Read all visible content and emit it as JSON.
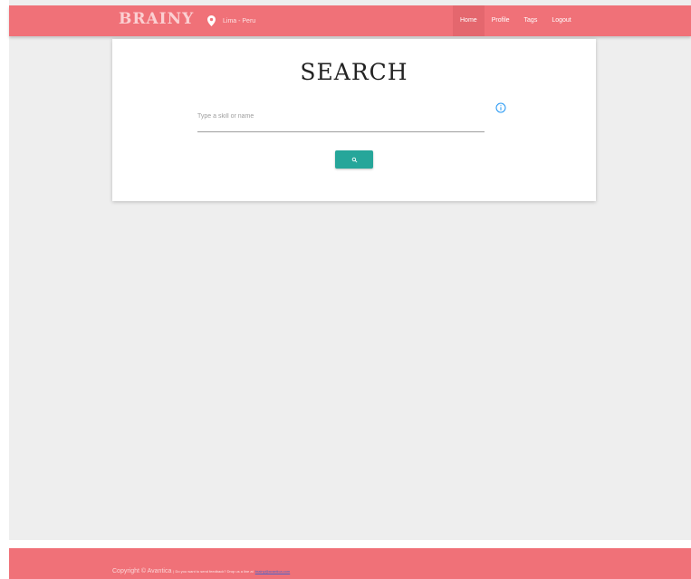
{
  "navbar": {
    "brand": "BRAINY",
    "location_icon": "map-marker-icon",
    "location": "Lima - Peru",
    "menu": [
      {
        "label": "Home",
        "active": true
      },
      {
        "label": "Profile",
        "active": false
      },
      {
        "label": "Tags",
        "active": false
      },
      {
        "label": "Logout",
        "active": false
      }
    ]
  },
  "search": {
    "title": "SEARCH",
    "placeholder": "Type a skill or name",
    "info_icon": "info-circle-icon",
    "button_icon": "search-icon"
  },
  "footer": {
    "copyright": "Copyright © Avantica",
    "note": "| Do you want to send feedback? Drop us a line at",
    "email": "brainy@avantica.com"
  },
  "colors": {
    "primary": "#f07178",
    "active_nav": "#e4676e",
    "button": "#26a69a",
    "info": "#2196f3",
    "background": "#eeeeee"
  }
}
